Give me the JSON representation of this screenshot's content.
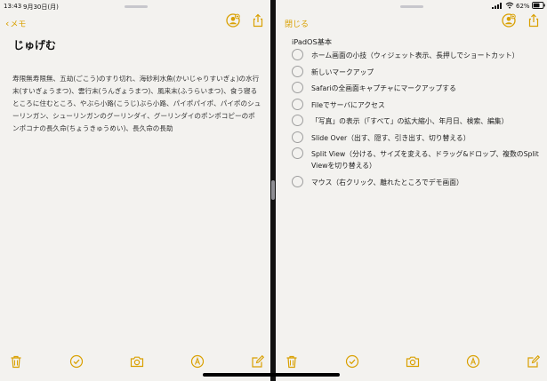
{
  "status_bar": {
    "time": "13:43",
    "date": "9月30日(月)",
    "battery": "62%"
  },
  "left_pane": {
    "back_label": "メモ",
    "note_title": "じゅげむ",
    "note_body": "寿限無寿限無、五劫(ごこう)のすり切れ、海砂利水魚(かいじゃりすいぎょ)の水行末(すいぎょうまつ)、雲行末(うんぎょうまつ)、風来末(ふうらいまつ)、食う寝るところに住むところ、やぶら小路(こうじ)ぶら小路、パイポパイポ、パイポのシューリンガン、シューリンガンのグーリンダイ、グーリンダイのポンポコピーのポンポコナの長久命(ちょうきゅうめい)、長久命の長助"
  },
  "right_pane": {
    "close_label": "閉じる",
    "list_title": "iPadOS基本",
    "items": [
      "ホーム画面の小技（ウィジェット表示、長押しでショートカット）",
      "新しいマークアップ",
      "Safariの全画面キャプチャにマークアップする",
      "Fileでサーバにアクセス",
      "「写真」の表示（「すべて」の拡大縮小、年月日、検索、編集）",
      "Slide Over（出す、隠す、引き出す、切り替える）",
      "Split View（分ける、サイズを変える、ドラッグ&ドロップ、複数のSplit Viewを切り替える）",
      "マウス（右クリック、離れたところでデモ画面）"
    ]
  },
  "colors": {
    "accent": "#d9a000",
    "paper": "#f3f2ef",
    "divider": "#111111"
  },
  "icons": {
    "back": "chevron-left-icon",
    "share": "share-icon",
    "collaborate": "add-person-icon",
    "trash": "trash-icon",
    "checklist": "checkmark-circle-icon",
    "camera": "camera-icon",
    "markup": "markup-pen-icon",
    "compose": "compose-icon",
    "wifi": "wifi-icon",
    "battery": "battery-icon"
  }
}
